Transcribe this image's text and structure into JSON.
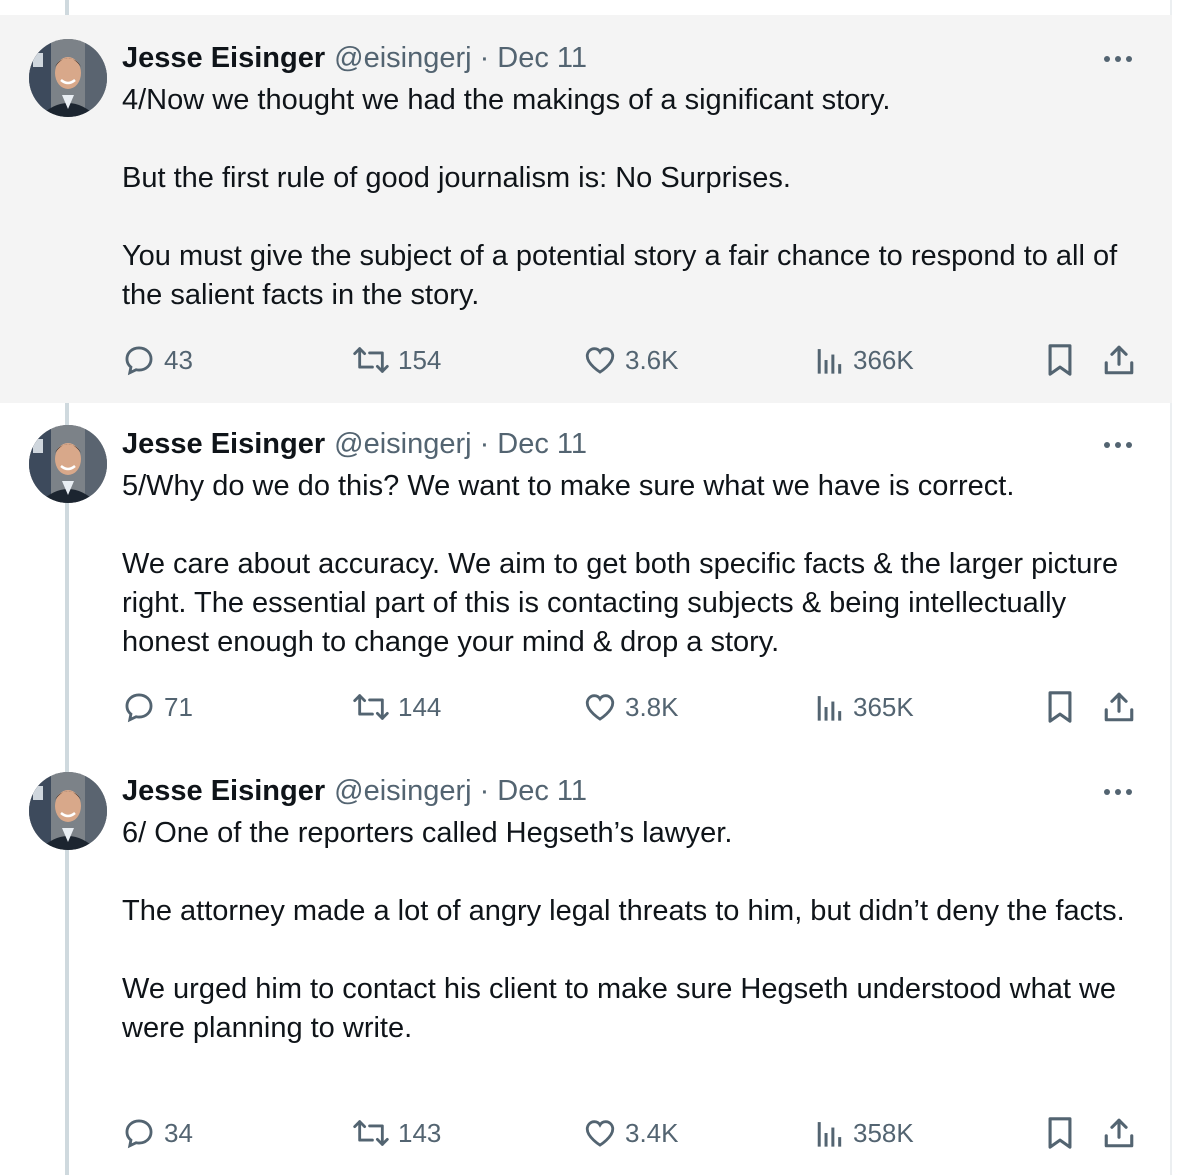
{
  "tweets": [
    {
      "author": "Jesse Eisinger",
      "handle": "@eisingerj",
      "separator": "·",
      "date": "Dec 11",
      "paragraphs": [
        "4/Now we thought we had the makings of a significant story.",
        "But the first rule of good journalism is: No Surprises.",
        "You must give the subject of a potential story a fair chance to respond to all of the salient facts in the story."
      ],
      "replies": "43",
      "reposts": "154",
      "likes": "3.6K",
      "views": "366K"
    },
    {
      "author": "Jesse Eisinger",
      "handle": "@eisingerj",
      "separator": "·",
      "date": "Dec 11",
      "paragraphs": [
        "5/Why do we do this? We want to make sure what we have is correct.",
        "We care about accuracy. We aim to get both specific facts & the larger picture right. The essential part of this is contacting subjects & being intellectually honest enough to change your mind & drop a story."
      ],
      "replies": "71",
      "reposts": "144",
      "likes": "3.8K",
      "views": "365K"
    },
    {
      "author": "Jesse Eisinger",
      "handle": "@eisingerj",
      "separator": "·",
      "date": "Dec 11",
      "paragraphs": [
        "6/ One of the reporters called Hegseth’s lawyer.",
        "The attorney made a lot of angry legal threats to him, but didn’t deny the facts.",
        "We urged him to contact his client to make sure Hegseth understood what we were planning to write."
      ],
      "replies": "34",
      "reposts": "143",
      "likes": "3.4K",
      "views": "358K"
    }
  ],
  "icons": {
    "reply": "reply-icon",
    "repost": "repost-icon",
    "like": "heart-icon",
    "views": "views-icon",
    "bookmark": "bookmark-icon",
    "share": "share-icon",
    "more": "more-icon"
  },
  "colors": {
    "text": "#0f1419",
    "secondary": "#536471",
    "highlight_bg": "#f4f4f4",
    "thread_line": "#cfd9de"
  }
}
